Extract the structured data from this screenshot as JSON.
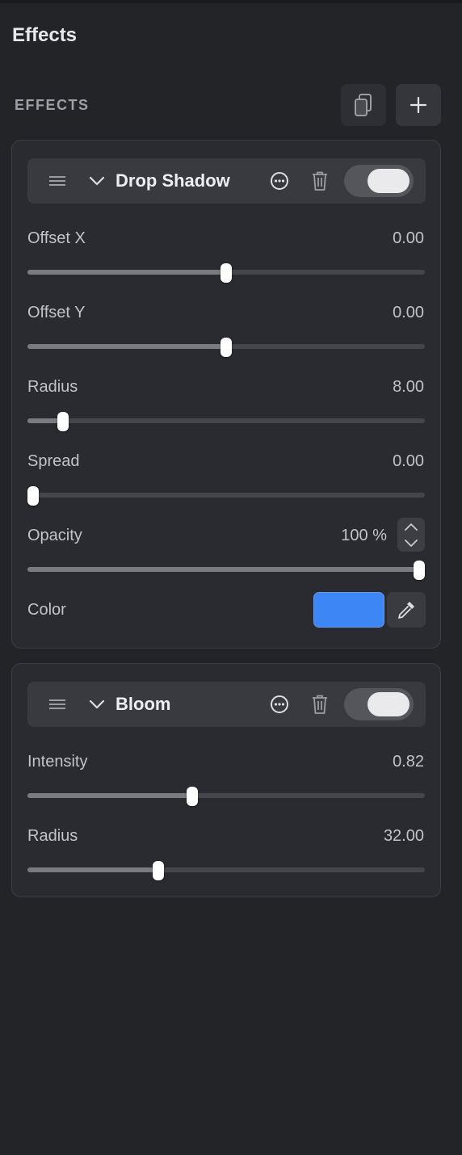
{
  "page": {
    "title": "Effects"
  },
  "section": {
    "label": "EFFECTS",
    "copy_icon": "copy-icon",
    "add_icon": "plus-icon"
  },
  "effects": [
    {
      "name": "Drop Shadow",
      "enabled": true,
      "params": [
        {
          "label": "Offset X",
          "value": "0.00",
          "fraction": 0.5
        },
        {
          "label": "Offset Y",
          "value": "0.00",
          "fraction": 0.5
        },
        {
          "label": "Radius",
          "value": "8.00",
          "fraction": 0.078
        },
        {
          "label": "Spread",
          "value": "0.00",
          "fraction": 0.0
        },
        {
          "label": "Opacity",
          "value": "100 %",
          "fraction": 1.0
        }
      ],
      "color": {
        "label": "Color",
        "value": "#3c86f6"
      }
    },
    {
      "name": "Bloom",
      "enabled": true,
      "params": [
        {
          "label": "Intensity",
          "value": "0.82",
          "fraction": 0.413
        },
        {
          "label": "Radius",
          "value": "32.00",
          "fraction": 0.324
        }
      ]
    }
  ],
  "colors": {
    "slider_fill": "#7a7b80",
    "toggle_on": "#55565c"
  }
}
